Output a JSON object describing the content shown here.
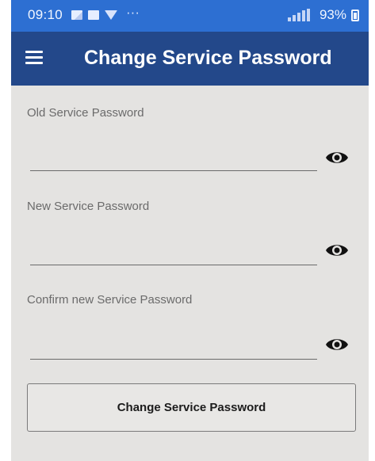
{
  "status_bar": {
    "time": "09:10",
    "battery": "93%",
    "dots": "···"
  },
  "app_bar": {
    "title": "Change Service Password",
    "menu_icon": "hamburger-menu-icon"
  },
  "form": {
    "fields": [
      {
        "label": "Old Service Password",
        "value": "",
        "icon": "eye-icon"
      },
      {
        "label": "New Service Password",
        "value": "",
        "icon": "eye-icon"
      },
      {
        "label": "Confirm new Service Password",
        "value": "",
        "icon": "eye-icon"
      }
    ],
    "submit_label": "Change Service Password"
  },
  "colors": {
    "status_bar": "#2d6fd2",
    "app_bar": "#23488a",
    "background": "#e4e3e1"
  }
}
